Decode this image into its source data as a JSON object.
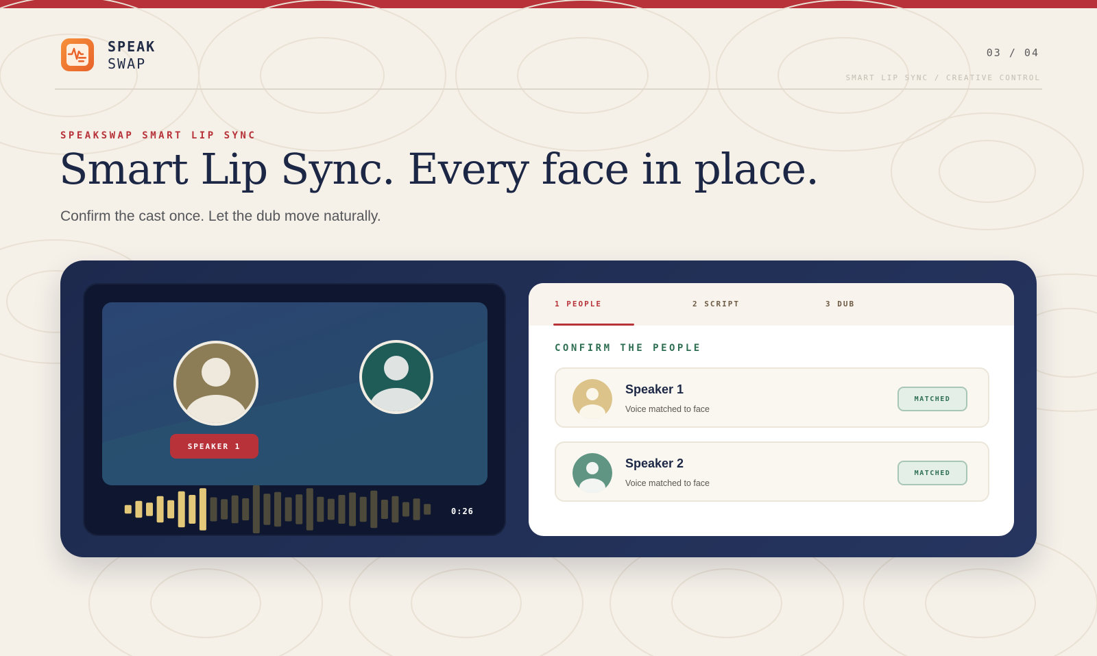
{
  "brand": {
    "line1": "SPEAK",
    "line2": "SWAP"
  },
  "header": {
    "page_indicator": "03 / 04",
    "breadcrumb": "SMART LIP SYNC / CREATIVE CONTROL"
  },
  "hero": {
    "eyebrow": "SPEAKSWAP SMART LIP SYNC",
    "title": "Smart Lip Sync. Every face in place.",
    "subtitle": "Confirm the cast once. Let the dub move naturally."
  },
  "player": {
    "active_speaker_tag": "SPEAKER 1",
    "timestamp": "0:26",
    "waveform_levels": [
      0.18,
      0.35,
      0.28,
      0.55,
      0.38,
      0.75,
      0.6,
      0.88,
      0.5,
      0.42,
      0.58,
      0.46,
      1.0,
      0.65,
      0.72,
      0.5,
      0.62,
      0.88,
      0.52,
      0.44,
      0.6,
      0.7,
      0.52,
      0.78,
      0.4,
      0.55,
      0.3,
      0.45,
      0.22
    ],
    "waveform_played_fraction": 0.26
  },
  "panel": {
    "tabs": [
      {
        "label": "1 PEOPLE",
        "active": true
      },
      {
        "label": "2 SCRIPT",
        "active": false
      },
      {
        "label": "3 DUB",
        "active": false
      }
    ],
    "section_title": "CONFIRM THE PEOPLE",
    "speakers": [
      {
        "name": "Speaker 1",
        "description": "Voice matched to face",
        "status": "MATCHED"
      },
      {
        "name": "Speaker 2",
        "description": "Voice matched to face",
        "status": "MATCHED"
      }
    ]
  },
  "colors": {
    "accent_red": "#b8323a",
    "navy": "#1c2745",
    "green": "#2d6e52",
    "gold_wave": "#e3c87a",
    "dim_wave": "#4d4a3b"
  }
}
